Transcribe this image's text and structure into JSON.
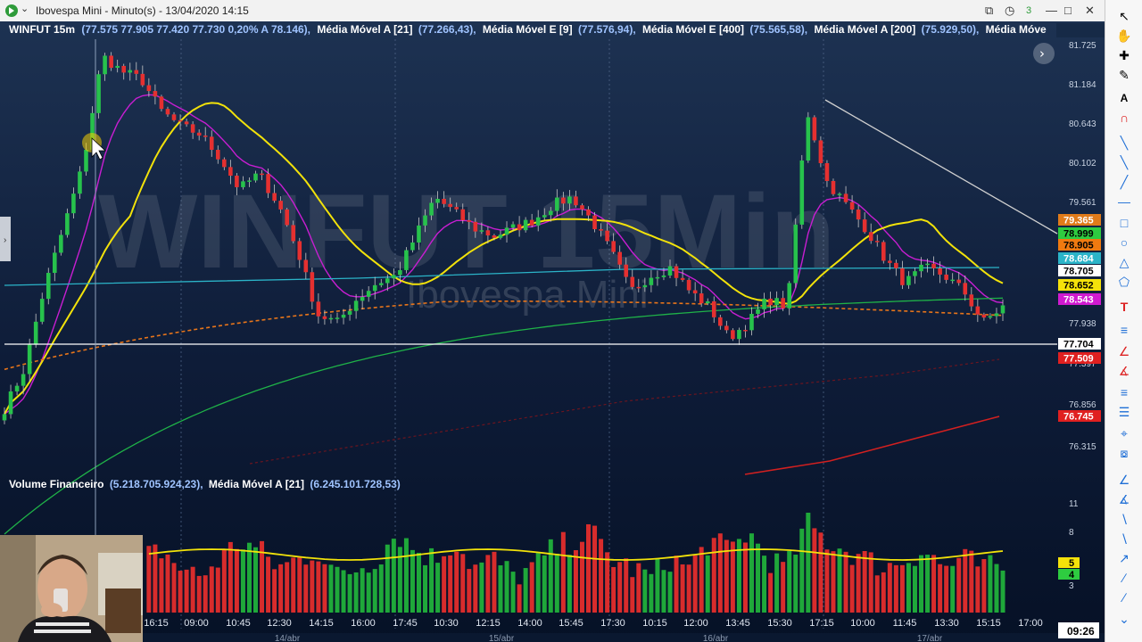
{
  "window": {
    "title": "Ibovespa Mini - Minuto(s) - 13/04/2020 14:15",
    "notification_count": "3"
  },
  "legend": {
    "symbol": "WINFUT 15m",
    "ohlc": "(77.575  77.905  77.420  77.730  0,20%  A 78.146),",
    "items": [
      {
        "label": "Média Móvel A [21]",
        "value": "(77.266,43),"
      },
      {
        "label": "Média Móvel E [9]",
        "value": "(77.576,94),"
      },
      {
        "label": "Média Móvel E [400]",
        "value": "(75.565,58),"
      },
      {
        "label": "Média Móvel A [200]",
        "value": "(75.929,50),"
      },
      {
        "label": "Média Móve",
        "value": ""
      }
    ]
  },
  "watermark": {
    "main": "WINFUT 15Min",
    "sub": "Ibovespa Mini"
  },
  "price_axis": {
    "ticks": [
      "81.725",
      "81.184",
      "80.643",
      "80.102",
      "79.561",
      "77.938",
      "77.397",
      "76.856",
      "76.315"
    ],
    "badges": [
      {
        "value": "79.365",
        "color": "#e07b1a",
        "text_color": "#ffffff"
      },
      {
        "value": "78.999",
        "color": "#2ecc40",
        "text_color": "#000000"
      },
      {
        "value": "78.905",
        "color": "#f07a10",
        "text_color": "#000000"
      },
      {
        "value": "78.684",
        "color": "#2bb4c8",
        "text_color": "#ffffff"
      },
      {
        "value": "78.705",
        "color": "#ffffff",
        "text_color": "#000000"
      },
      {
        "value": "78.652",
        "color": "#f5e20a",
        "text_color": "#000000"
      },
      {
        "value": "78.543",
        "color": "#d01ad0",
        "text_color": "#ffffff"
      },
      {
        "value": "77.704",
        "color": "#ffffff",
        "text_color": "#000000"
      },
      {
        "value": "77.509",
        "color": "#e02020",
        "text_color": "#ffffff"
      },
      {
        "value": "76.745",
        "color": "#e02020",
        "text_color": "#ffffff"
      }
    ]
  },
  "volume_panel": {
    "label": "Volume Financeiro",
    "value": "(5.218.705.924,23),",
    "ma_label": "Média Móvel A [21]",
    "ma_value": "(6.245.101.728,53)",
    "ticks": [
      "11",
      "8",
      "3"
    ],
    "badges": [
      {
        "value": "5",
        "color": "#f5e20a"
      },
      {
        "value": "4",
        "color": "#2ecc40"
      }
    ]
  },
  "time_axis": {
    "labels": [
      "16:15",
      "09:00",
      "10:45",
      "12:30",
      "14:15",
      "16:00",
      "17:45",
      "10:30",
      "12:15",
      "14:00",
      "15:45",
      "17:30",
      "10:15",
      "12:00",
      "13:45",
      "15:30",
      "17:15",
      "10:00",
      "11:45",
      "13:30",
      "15:15",
      "17:00"
    ],
    "dates": [
      "14/abr",
      "15/abr",
      "16/abr",
      "17/abr"
    ],
    "current_time": "09:26"
  },
  "chart_data": {
    "type": "candlestick",
    "title": "WINFUT 15m",
    "ylim": [
      76100,
      81900
    ],
    "series": [
      {
        "name": "Média Móvel A [21]",
        "color": "#f2e20a"
      },
      {
        "name": "Média Móvel E [9]",
        "color": "#c81ed2"
      },
      {
        "name": "Média Móvel E [400]",
        "color": "#e8751a"
      },
      {
        "name": "Média Móvel A [200]",
        "color": "#1fb248"
      }
    ],
    "anchors_close": [
      77200,
      77700,
      78700,
      79500,
      80300,
      81700,
      81500,
      81400,
      81000,
      80800,
      80700,
      80400,
      80000,
      80200,
      79800,
      79200,
      78400,
      78300,
      78600,
      78800,
      78900,
      79400,
      79900,
      79700,
      79500,
      79400,
      79500,
      79600,
      79800,
      79900,
      79600,
      79200,
      78700,
      78900,
      79000,
      78700,
      78500,
      78100,
      78300,
      78600,
      78500,
      81000,
      80100,
      79800,
      79500,
      79100,
      78800,
      79000,
      78900,
      78700,
      78300,
      78500
    ],
    "volume_anchors": [
      5,
      6,
      7,
      4,
      6,
      5,
      8,
      6,
      7,
      5,
      4,
      6,
      8,
      7,
      5,
      6,
      7,
      4,
      5,
      6,
      9,
      7,
      6,
      8,
      5,
      6,
      4,
      5,
      7,
      8,
      9,
      6,
      5,
      4,
      6,
      5,
      8,
      7,
      9,
      6,
      5,
      10,
      8,
      7,
      6,
      5,
      6,
      7,
      5,
      6,
      5,
      5
    ]
  }
}
